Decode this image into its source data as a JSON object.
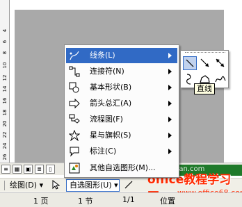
{
  "ruler": {
    "numbers": [
      "4",
      "6",
      "8",
      "10",
      "12",
      "14",
      "16",
      "18",
      "20",
      "22",
      "24",
      "26"
    ]
  },
  "autoshapes_menu": {
    "items": [
      {
        "label": "线条(L)",
        "icon": "lines-icon",
        "has_submenu": true,
        "highlighted": true
      },
      {
        "label": "连接符(N)",
        "icon": "connector-icon",
        "has_submenu": true
      },
      {
        "label": "基本形状(B)",
        "icon": "basic-shapes-icon",
        "has_submenu": true
      },
      {
        "label": "箭头总汇(A)",
        "icon": "block-arrows-icon",
        "has_submenu": true
      },
      {
        "label": "流程图(F)",
        "icon": "flowchart-icon",
        "has_submenu": true
      },
      {
        "label": "星与旗帜(S)",
        "icon": "stars-banners-icon",
        "has_submenu": true
      },
      {
        "label": "标注(C)",
        "icon": "callouts-icon",
        "has_submenu": true
      },
      {
        "label": "其他自选图形(M)...",
        "icon": "more-autoshapes-icon",
        "has_submenu": false
      }
    ]
  },
  "lines_submenu": {
    "buttons": [
      {
        "name": "line-icon",
        "selected": true
      },
      {
        "name": "arrow-icon"
      },
      {
        "name": "double-arrow-icon"
      },
      {
        "name": "curve-icon"
      },
      {
        "name": "freeform-icon"
      },
      {
        "name": "scribble-icon"
      }
    ],
    "tooltip": "直线"
  },
  "drawing_toolbar": {
    "draw_label": "绘图(D)",
    "autoshapes_label": "自选图形(U)",
    "autoshapes_arrow": "▾"
  },
  "statusbar": {
    "page": "1 页",
    "section": "1 节",
    "page_of": "1/1",
    "position": "位置"
  },
  "watermark": {
    "title": "office教程学习网",
    "url": "www.office68.com",
    "faint": "officejiayuan.com"
  },
  "colors": {
    "highlight": "#316ac5",
    "workspace_gray": "#a9a9a9",
    "watermark_red": "#ff2a00",
    "watermark_green": "#1f7a2a"
  }
}
